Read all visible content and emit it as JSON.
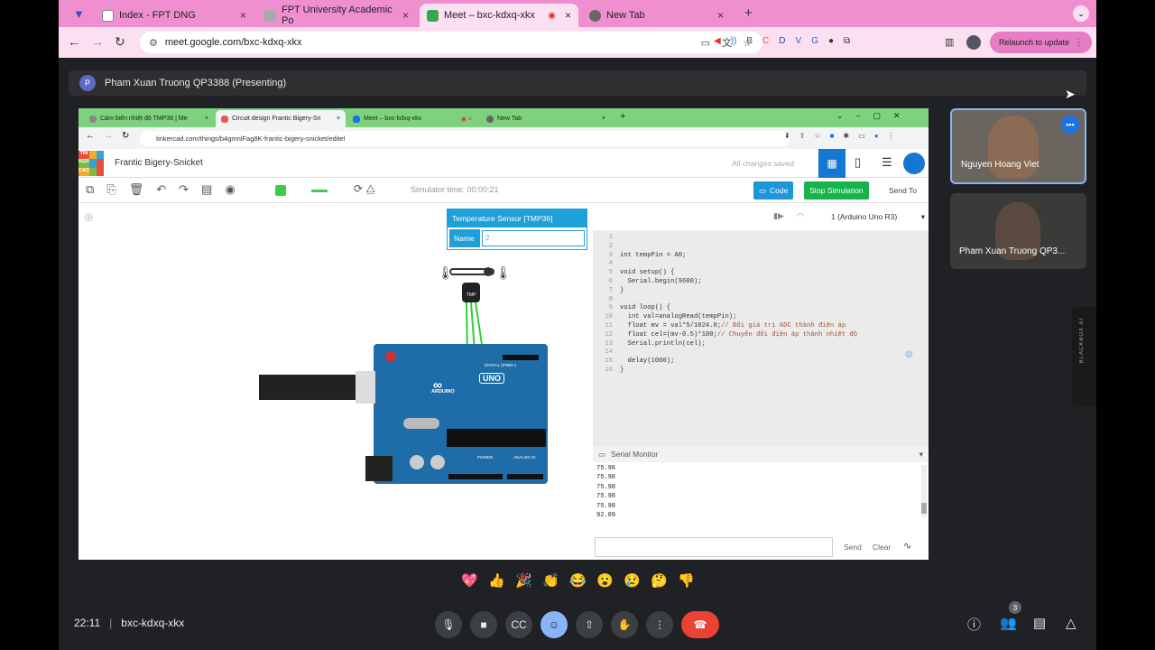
{
  "browser": {
    "tabs": [
      {
        "label": "Index - FPT DNG",
        "close": "×"
      },
      {
        "label": "FPT University Academic Po",
        "close": "×"
      },
      {
        "label": "Meet – bxc-kdxq-xkx",
        "close": "×"
      },
      {
        "label": "New Tab",
        "close": "×"
      }
    ],
    "new_tab": "+",
    "url": "meet.google.com/bxc-kdxq-xkx",
    "relaunch_label": "Relaunch to update"
  },
  "meet": {
    "presenter_initial": "P",
    "presenter_text": "Pham Xuan Truong QP3388 (Presenting)",
    "participants": [
      {
        "name": "Nguyen Hoang Viet"
      },
      {
        "name": "Pham Xuan Truong QP3..."
      }
    ],
    "time": "22:11",
    "meeting_code": "bxc-kdxq-xkx",
    "people_count": "3",
    "reactions": [
      "💖",
      "👍",
      "🎉",
      "👏",
      "😂",
      "😮",
      "😢",
      "🤔",
      "👎"
    ]
  },
  "shared": {
    "tabs": [
      {
        "label": "Cảm biến nhiệt độ TMP36 | Me"
      },
      {
        "label": "Circuit design Frantic Bigery-Sn"
      },
      {
        "label": "Meet – bxc-kdxq-xkx"
      },
      {
        "label": "New Tab"
      }
    ],
    "url": "tinkercad.com/things/b4gmnlFag8K-frantic-bigery-snicket/editel",
    "logo": [
      "TIN",
      "KER",
      "CAD"
    ],
    "project_title": "Frantic Bigery-Snicket",
    "saved_status": "All changes saved",
    "sim_time": "Simulator time: 00:00:21",
    "code_btn": "Code",
    "stop_btn": "Stop Simulation",
    "send_to": "Send To",
    "component_title": "Temperature Sensor [TMP36]",
    "name_label": "Name",
    "name_value": "2",
    "sensor_label": "TMP",
    "board_select": "1 (Arduino Uno R3)",
    "board_labels": {
      "brand": "ARDUINO",
      "model": "UNO",
      "digital": "DIGITAL (PWM~)",
      "power": "POWER",
      "analog": "ANALOG IN"
    },
    "code_lines": [
      "",
      "",
      "int tempPin = A0;",
      "",
      "void setup() {",
      "  Serial.begin(9600);",
      "}",
      "",
      "void loop() {",
      "  int val=analogRead(tempPin);",
      "  float mv = val*5/1024.0;// Đổi giá trị ADC thành điện áp",
      "  float cel=(mv-0.5)*100;// Chuyển đổi điện áp thành nhiệt độ",
      "  Serial.println(cel);",
      "",
      "  delay(1000);",
      "}"
    ],
    "serial_title": "Serial Monitor",
    "serial_output": [
      "75.98",
      "75.98",
      "75.98",
      "75.98",
      "75.98",
      "92.09"
    ],
    "send_btn": "Send",
    "clear_btn": "Clear",
    "blackbox_label": "BLACKBOX AI"
  },
  "colors": {
    "chrome_pink": "#f08fd0",
    "meet_bg": "#202124",
    "tinker_green": "#7ed27d",
    "tinker_blue": "#1477d2",
    "sim_green": "#17b34c",
    "end_call": "#ea4335"
  }
}
